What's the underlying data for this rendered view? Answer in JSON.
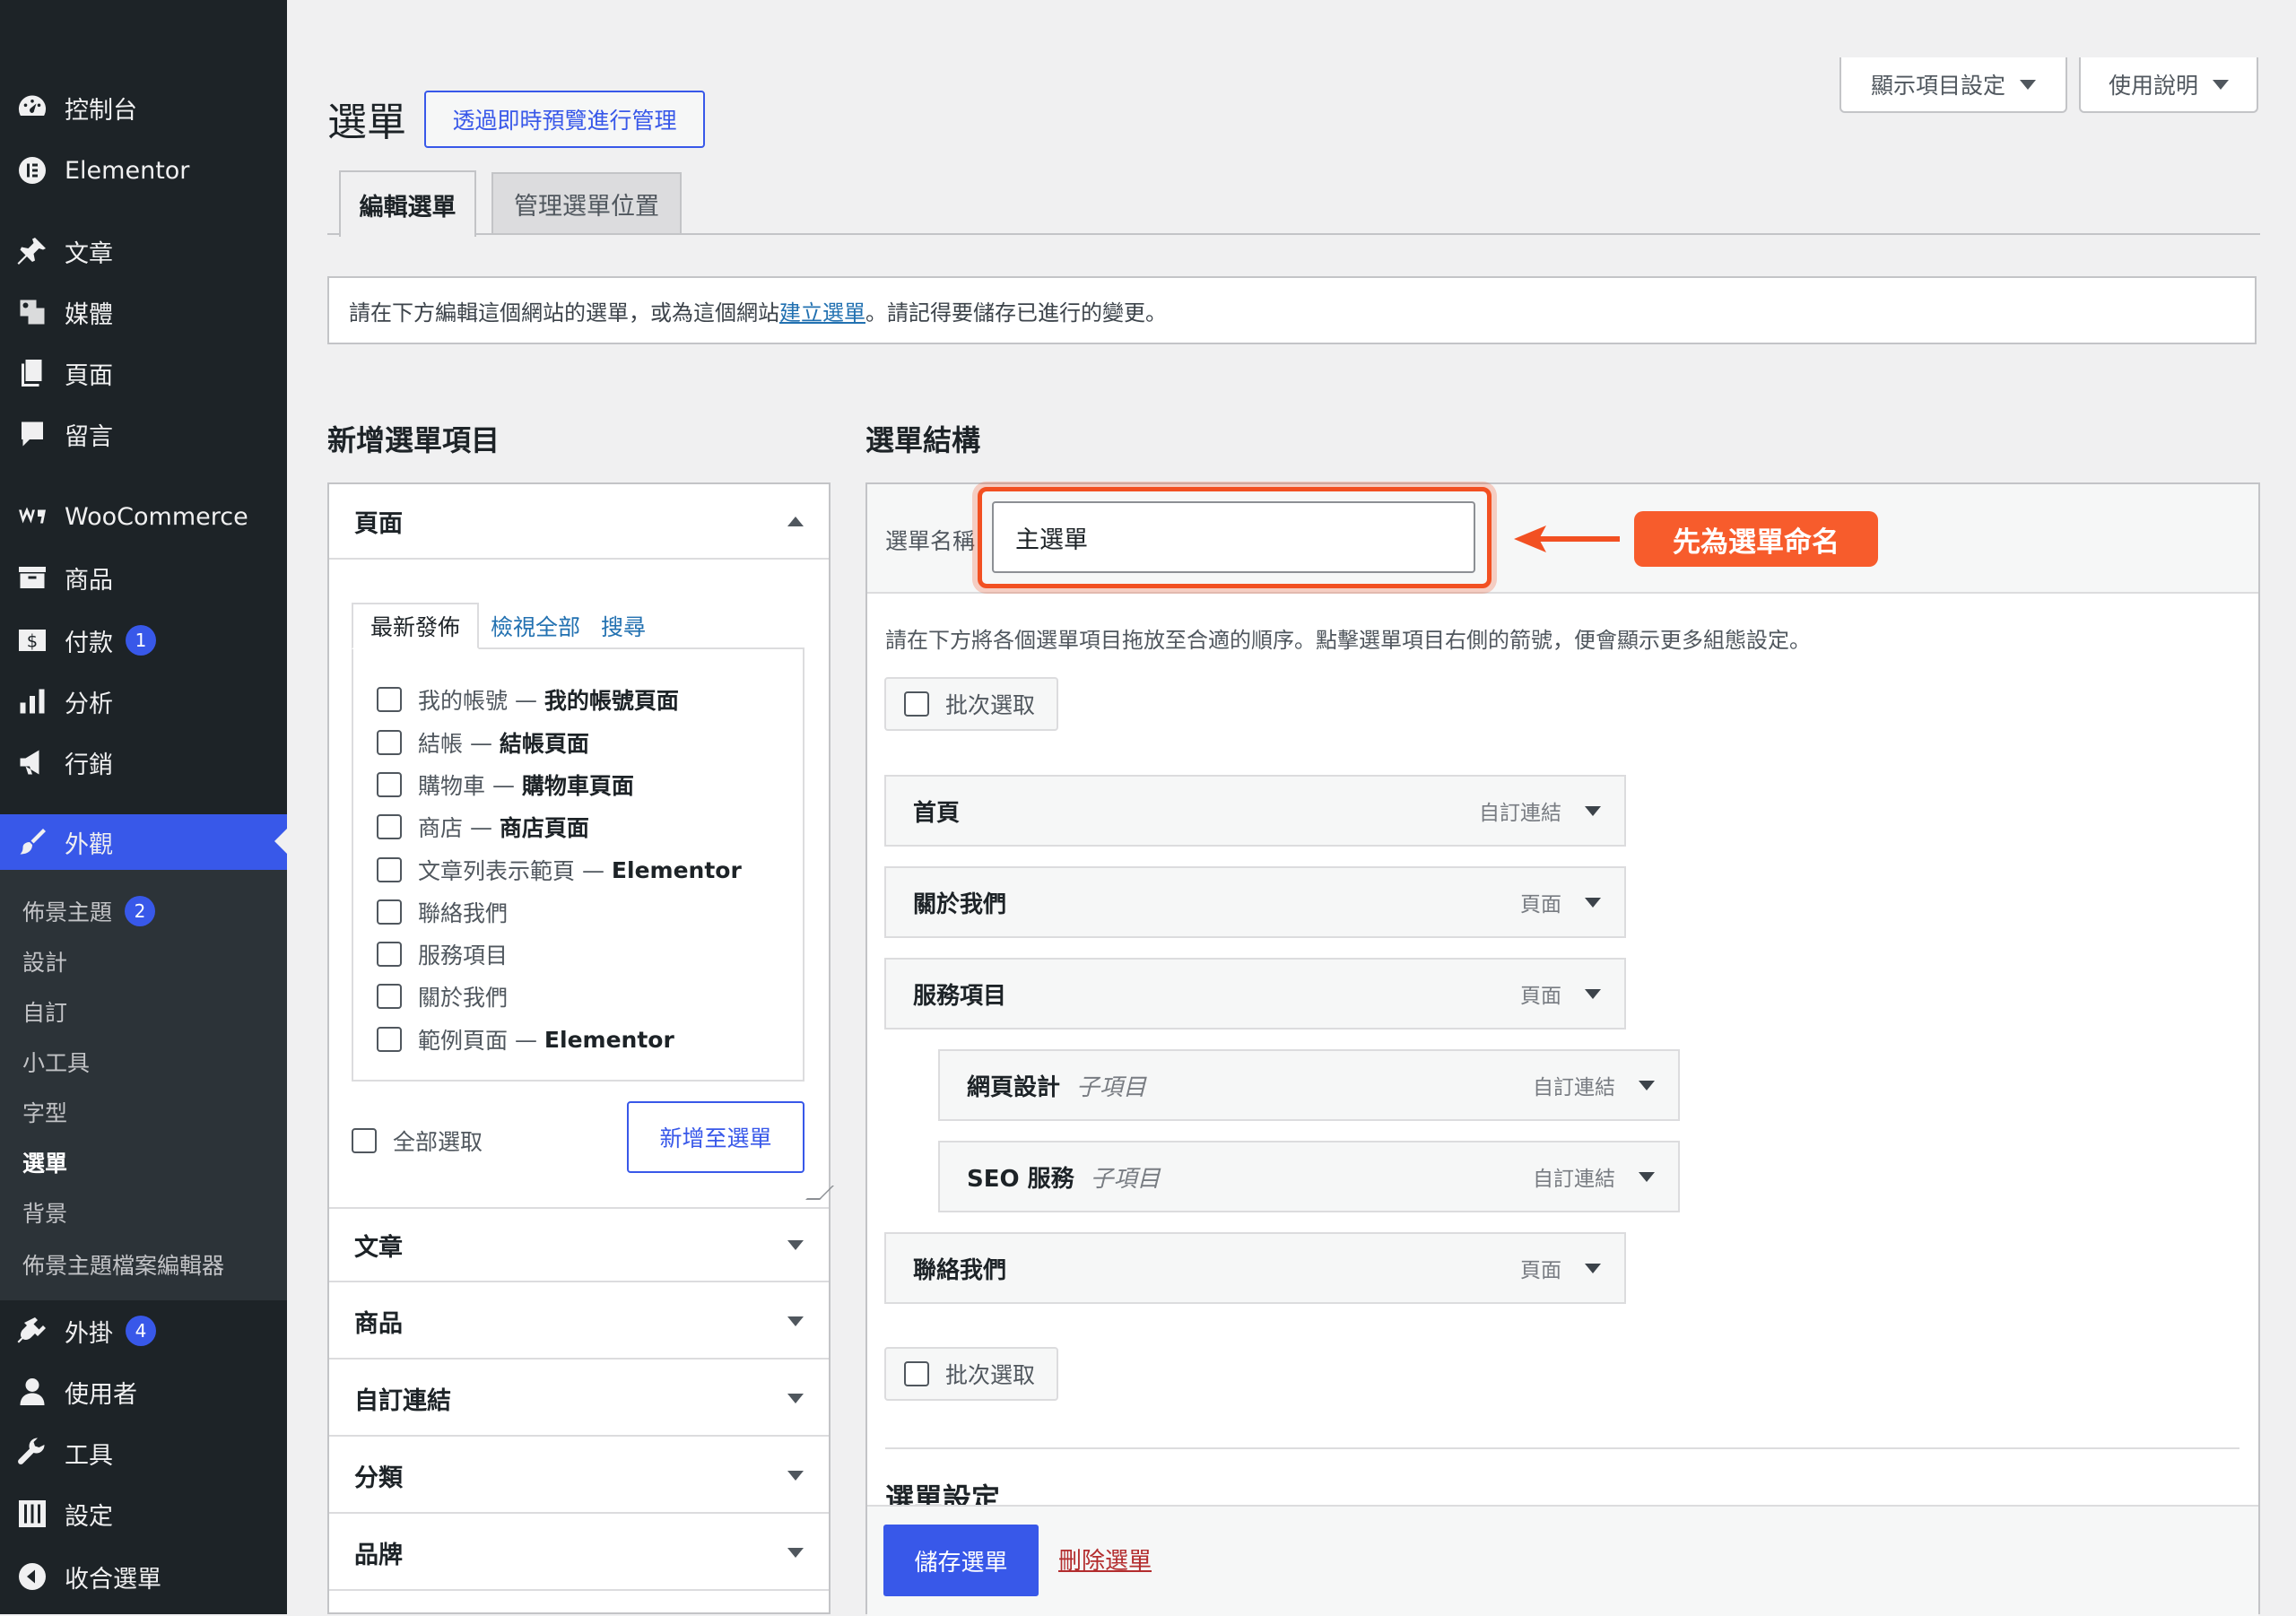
{
  "sidebar": {
    "items": [
      {
        "label": "控制台",
        "icon": "dashboard-icon"
      },
      {
        "label": "Elementor",
        "icon": "elementor-icon"
      },
      {
        "label": "文章",
        "icon": "pin-icon"
      },
      {
        "label": "媒體",
        "icon": "media-icon"
      },
      {
        "label": "頁面",
        "icon": "pages-icon"
      },
      {
        "label": "留言",
        "icon": "comment-icon"
      },
      {
        "label": "WooCommerce",
        "icon": "woocommerce-icon"
      },
      {
        "label": "商品",
        "icon": "archive-icon"
      },
      {
        "label": "付款",
        "icon": "payment-icon",
        "badge": "1"
      },
      {
        "label": "分析",
        "icon": "bar-chart-icon"
      },
      {
        "label": "行銷",
        "icon": "megaphone-icon"
      },
      {
        "label": "外觀",
        "icon": "paintbrush-icon"
      },
      {
        "label": "外掛",
        "icon": "plugin-icon",
        "badge": "4"
      },
      {
        "label": "使用者",
        "icon": "user-icon"
      },
      {
        "label": "工具",
        "icon": "wrench-icon"
      },
      {
        "label": "設定",
        "icon": "settings-icon"
      },
      {
        "label": "收合選單",
        "icon": "collapse-icon"
      }
    ],
    "submenu": [
      {
        "label": "佈景主題",
        "badge": "2"
      },
      {
        "label": "設計"
      },
      {
        "label": "自訂"
      },
      {
        "label": "小工具"
      },
      {
        "label": "字型"
      },
      {
        "label": "選單"
      },
      {
        "label": "背景"
      },
      {
        "label": "佈景主題檔案編輯器"
      }
    ]
  },
  "header": {
    "title": "選單",
    "live_preview_button": "透過即時預覽進行管理",
    "screen_options": "顯示項目設定",
    "help": "使用說明"
  },
  "tabs": [
    "編輯選單",
    "管理選單位置"
  ],
  "notice": {
    "before": "請在下方編輯這個網站的選單，或為這個網站",
    "link": "建立選單",
    "after": "。請記得要儲存已進行的變更。"
  },
  "add_items": {
    "heading": "新增選單項目",
    "pages_section": "頁面",
    "subtabs": [
      "最新發佈",
      "檢視全部",
      "搜尋"
    ],
    "pages": [
      {
        "name": "我的帳號",
        "suffix": "我的帳號頁面"
      },
      {
        "name": "結帳",
        "suffix": "結帳頁面"
      },
      {
        "name": "購物車",
        "suffix": "購物車頁面"
      },
      {
        "name": "商店",
        "suffix": "商店頁面"
      },
      {
        "name": "文章列表示範頁",
        "suffix": "Elementor"
      },
      {
        "name": "聯絡我們",
        "suffix": ""
      },
      {
        "name": "服務項目",
        "suffix": ""
      },
      {
        "name": "關於我們",
        "suffix": ""
      },
      {
        "name": "範例頁面",
        "suffix": "Elementor"
      }
    ],
    "select_all": "全部選取",
    "add_button": "新增至選單",
    "sections": [
      "文章",
      "商品",
      "自訂連結",
      "分類",
      "品牌"
    ]
  },
  "structure": {
    "heading": "選單結構",
    "name_label": "選單名稱",
    "name_value": "主選單",
    "callout": "先為選單命名",
    "instructions": "請在下方將各個選單項目拖放至合適的順序。點擊選單項目右側的箭號，便會顯示更多組態設定。",
    "bulk_select": "批次選取",
    "items": [
      {
        "title": "首頁",
        "sub": "",
        "type": "自訂連結"
      },
      {
        "title": "關於我們",
        "sub": "",
        "type": "頁面"
      },
      {
        "title": "服務項目",
        "sub": "",
        "type": "頁面"
      },
      {
        "title": "網頁設計",
        "sub": "子項目",
        "type": "自訂連結"
      },
      {
        "title": "SEO 服務",
        "sub": "子項目",
        "type": "自訂連結"
      },
      {
        "title": "聯絡我們",
        "sub": "",
        "type": "頁面"
      }
    ],
    "settings_heading": "選單設定",
    "save_button": "儲存選單",
    "delete_link": "刪除選單"
  },
  "colors": {
    "accent": "#3858e9",
    "sidebar": "#1d2327",
    "callout": "#f75c2c",
    "highlight": "#f25022"
  }
}
